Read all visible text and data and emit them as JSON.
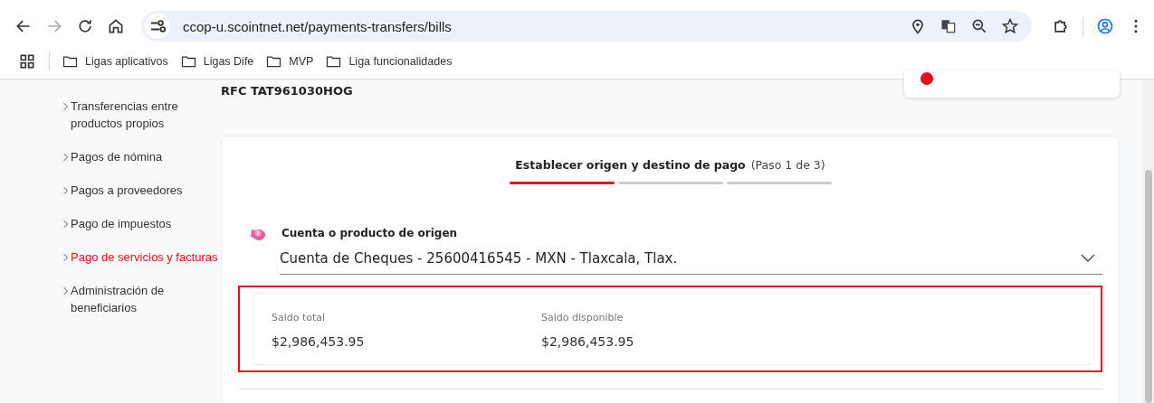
{
  "browser": {
    "url": "ccop-u.scointnet.net/payments-transfers/bills",
    "bookmarks": [
      "Ligas aplicativos",
      "Ligas Dife",
      "MVP",
      "Liga funcionalidades"
    ]
  },
  "header": {
    "rfc": "RFC TAT961030HOG"
  },
  "sidebar": {
    "items": [
      {
        "label": "Transferencias entre productos propios",
        "selected": false
      },
      {
        "label": "Pagos de nómina",
        "selected": false
      },
      {
        "label": "Pagos a proveedores",
        "selected": false
      },
      {
        "label": "Pago de impuestos",
        "selected": false
      },
      {
        "label": "Pago de servicios y facturas",
        "selected": true
      },
      {
        "label": "Administración de beneficiarios",
        "selected": false
      }
    ]
  },
  "stepper": {
    "title": "Establecer origen y destino de pago",
    "step": "(Paso 1 de 3)",
    "segments": [
      {
        "active": true
      },
      {
        "active": false
      },
      {
        "active": false
      }
    ]
  },
  "origin": {
    "label": "Cuenta o producto de origen",
    "value": "Cuenta de Cheques - 25600416545 - MXN - Tlaxcala, Tlax."
  },
  "balances": [
    {
      "label": "Saldo total",
      "amount": "$2,986,453.95"
    },
    {
      "label": "Saldo disponible",
      "amount": "$2,986,453.95"
    }
  ]
}
